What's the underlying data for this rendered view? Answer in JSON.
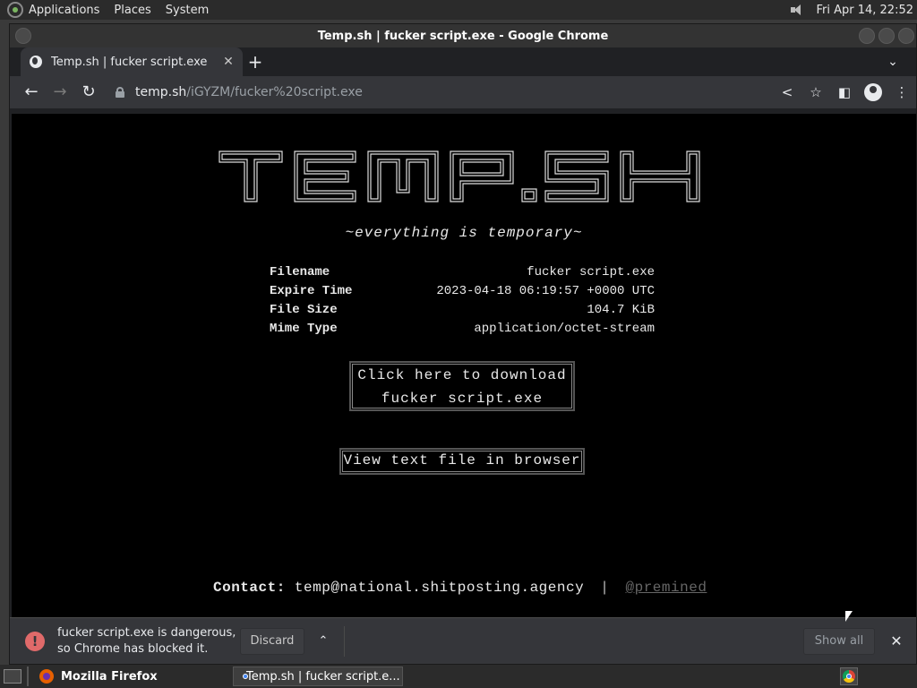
{
  "top_panel": {
    "menus": [
      "Applications",
      "Places",
      "System"
    ],
    "clock": "Fri Apr 14, 22:52"
  },
  "window": {
    "title": "Temp.sh | fucker script.exe - Google Chrome"
  },
  "tab": {
    "title": "Temp.sh | fucker script.exe",
    "close": "✕",
    "new_tab": "+"
  },
  "toolbar": {
    "url_host": "temp.sh",
    "url_path": "/iGYZM/fucker%20script.exe"
  },
  "page": {
    "logo_text": "TEMP.SH",
    "tagline": "~everything is temporary~",
    "info": [
      {
        "key": "Filename",
        "value": "fucker script.exe"
      },
      {
        "key": "Expire Time",
        "value": "2023-04-18 06:19:57 +0000 UTC"
      },
      {
        "key": "File Size",
        "value": "104.7 KiB"
      },
      {
        "key": "Mime Type",
        "value": "application/octet-stream"
      }
    ],
    "download_line1": "Click here to download",
    "download_line2": "fucker script.exe",
    "view_text": "View text file in browser",
    "contact_label": "Contact:",
    "contact_email": "temp@national.shitposting.agency",
    "contact_sep": "|",
    "contact_twitter": "@premined"
  },
  "download_bar": {
    "message": "fucker script.exe is dangerous, so Chrome has blocked it.",
    "discard": "Discard",
    "show_all": "Show all",
    "close": "✕"
  },
  "bottom_panel": {
    "firefox_task": "Mozilla Firefox",
    "chrome_task": "Temp.sh | fucker script.e..."
  },
  "colors": {
    "page_bg": "#000000",
    "chrome_dark": "#35363a",
    "warning": "#e06a6a"
  }
}
